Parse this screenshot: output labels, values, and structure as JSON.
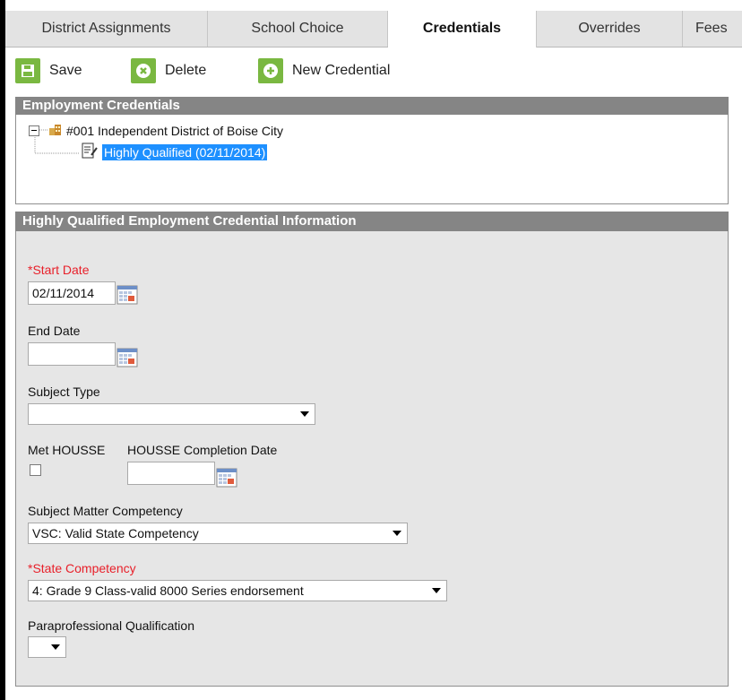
{
  "tabs": [
    {
      "label": "District Assignments"
    },
    {
      "label": "School Choice"
    },
    {
      "label": "Credentials"
    },
    {
      "label": "Overrides"
    },
    {
      "label": "Fees"
    }
  ],
  "toolbar": {
    "save_label": "Save",
    "delete_label": "Delete",
    "new_label": "New Credential"
  },
  "tree": {
    "header": "Employment Credentials",
    "root_label": "#001 Independent District of Boise City",
    "child_label": "Highly Qualified (02/11/2014)"
  },
  "form": {
    "header": "Highly Qualified Employment Credential Information",
    "start_date_label": "*Start Date",
    "start_date_value": "02/11/2014",
    "end_date_label": "End Date",
    "end_date_value": "",
    "subject_type_label": "Subject Type",
    "subject_type_value": "",
    "met_housse_label": "Met HOUSSE",
    "housse_completion_label": "HOUSSE Completion Date",
    "housse_completion_value": "",
    "subject_matter_label": "Subject Matter Competency",
    "subject_matter_value": "VSC: Valid State Competency",
    "state_competency_label": "*State Competency",
    "state_competency_value": "4: Grade 9 Class-valid 8000 Series endorsement",
    "parapro_label": "Paraprofessional Qualification",
    "parapro_value": ""
  },
  "colors": {
    "accent_green": "#7ab841",
    "required_red": "#e8202a",
    "selection_blue": "#1e90ff",
    "panel_header_gray": "#858585"
  }
}
